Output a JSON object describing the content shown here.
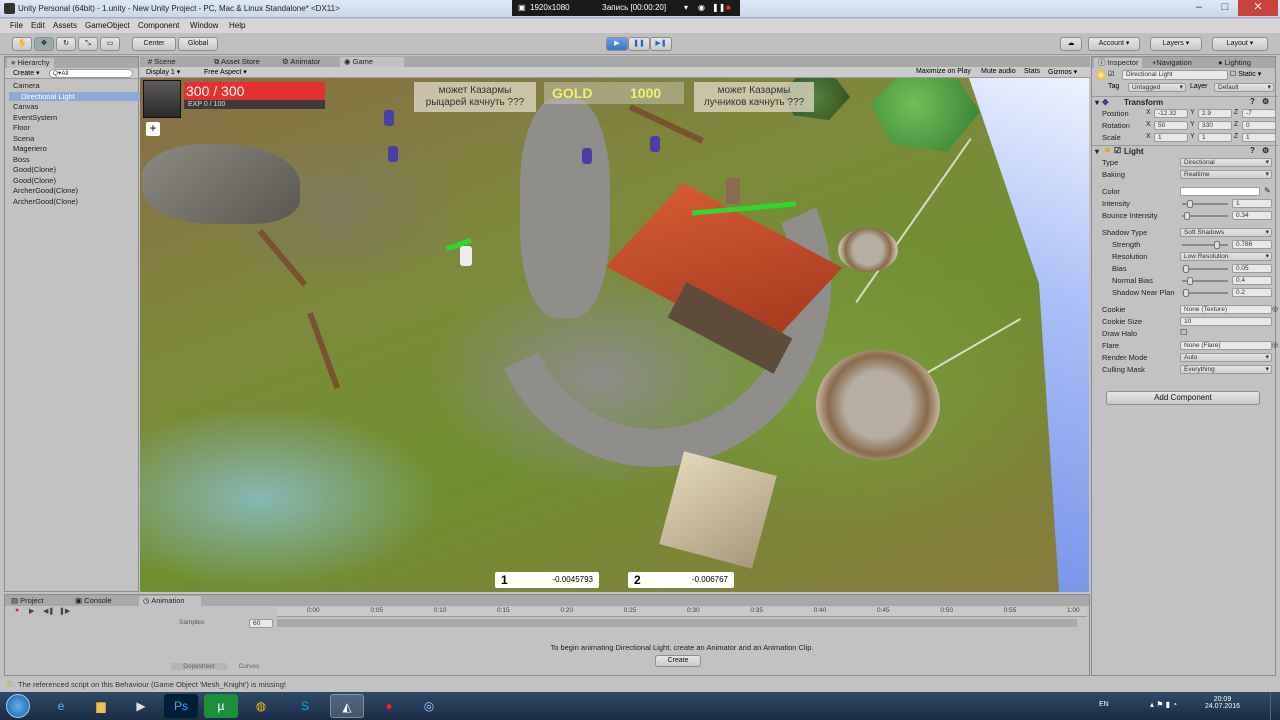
{
  "window": {
    "title": "Unity Personal (64bit) - 1.unity - New Unity Project - PC, Mac & Linux Standalone* <DX11>",
    "controls": [
      "–",
      "□",
      "✕"
    ]
  },
  "recorder": {
    "resolution": "1920x1080",
    "status": "Запись [00:00:20]"
  },
  "menu": [
    "File",
    "Edit",
    "Assets",
    "GameObject",
    "Component",
    "Window",
    "Help"
  ],
  "toolbar": {
    "pivot": "Center",
    "space": "Global",
    "account": "Account",
    "layers": "Layers",
    "layout": "Layout"
  },
  "hierarchy": {
    "tab": "Hierarchy",
    "create": "Create",
    "search_placeholder": "Q▾All",
    "items": [
      "Camera",
      "Directional Light",
      "Canvas",
      "EventSystem",
      "Floor",
      "Scena",
      "Mageriero",
      "Boss",
      "Good(Clone)",
      "Good(Clone)",
      "ArcherGood(Clone)",
      "ArcherGood(Clone)"
    ],
    "selected_index": 1
  },
  "center_tabs": {
    "scene": "Scene",
    "asset_store": "Asset Store",
    "animator": "Animator",
    "game": "Game"
  },
  "game_bar": {
    "display": "Display 1",
    "aspect": "Free Aspect",
    "maximize": "Maximize on Play",
    "mute": "Mute audio",
    "stats": "Stats",
    "gizmos": "Gizmos"
  },
  "hud": {
    "hp_text": "300 / 300",
    "exp_text": "EXP 0 / 100",
    "exp_fraction": 0.0,
    "plus": "+",
    "speech_left": "может Казармы\nрыцарей качнуть ???",
    "speech_right": "может Казармы\nлучников качнуть ???",
    "gold_label": "GOLD",
    "gold_value": "1000",
    "coord1_label": "1",
    "coord1_value": "-0.0045793",
    "coord2_label": "2",
    "coord2_value": "-0.006767"
  },
  "inspector": {
    "tabs": [
      "Inspector",
      "Navigation",
      "Lighting"
    ],
    "object_name": "Directional Light",
    "static_label": "Static",
    "tag_label": "Tag",
    "tag_value": "Untagged",
    "layer_label": "Layer",
    "layer_value": "Default",
    "transform": {
      "title": "Transform",
      "position_label": "Position",
      "position": [
        "-12.32",
        "2.9",
        "-7"
      ],
      "rotation_label": "Rotation",
      "rotation": [
        "50",
        "330",
        "0"
      ],
      "scale_label": "Scale",
      "scale": [
        "1",
        "1",
        "1"
      ]
    },
    "light": {
      "title": "Light",
      "type_label": "Type",
      "type_value": "Directional",
      "baking_label": "Baking",
      "baking_value": "Realtime",
      "color_label": "Color",
      "intensity_label": "Intensity",
      "intensity_value": "1",
      "bounce_label": "Bounce Intensity",
      "bounce_value": "0.34",
      "shadow_type_label": "Shadow Type",
      "shadow_type_value": "Soft Shadows",
      "strength_label": "Strength",
      "strength_value": "0.786",
      "resolution_label": "Resolution",
      "resolution_value": "Low Resolution",
      "bias_label": "Bias",
      "bias_value": "0.05",
      "normal_bias_label": "Normal Bias",
      "normal_bias_value": "0.4",
      "near_plane_label": "Shadow Near Plan",
      "near_plane_value": "0.2",
      "cookie_label": "Cookie",
      "cookie_value": "None (Texture)",
      "cookie_size_label": "Cookie Size",
      "cookie_size_value": "10",
      "draw_halo_label": "Draw Halo",
      "flare_label": "Flare",
      "flare_value": "None (Flare)",
      "render_mode_label": "Render Mode",
      "render_mode_value": "Auto",
      "culling_label": "Culling Mask",
      "culling_value": "Everything"
    },
    "add_component": "Add Component"
  },
  "bottom": {
    "tabs": [
      "Project",
      "Console",
      "Animation"
    ],
    "samples_label": "Samples",
    "samples_value": "60",
    "ruler": [
      "0:00",
      "0:05",
      "0:10",
      "0:15",
      "0:20",
      "0:25",
      "0:30",
      "0:35",
      "0:40",
      "0:45",
      "0:50",
      "0:55",
      "1:00"
    ],
    "message": "To begin animating Directional Light, create an Animator and an Animation Clip.",
    "create": "Create",
    "dopesheet": "Dopesheet",
    "curves": "Curves"
  },
  "status": "The referenced script on this Behaviour (Game Object 'Mesh_Knight') is missing!",
  "taskbar": {
    "lang": "EN",
    "time": "20:09",
    "date": "24.07.2016"
  },
  "colors": {
    "hp": "#e53030",
    "gold_text": "#f3ef70",
    "selection": "#8ea8d8",
    "play_blue": "#3d73c6"
  }
}
